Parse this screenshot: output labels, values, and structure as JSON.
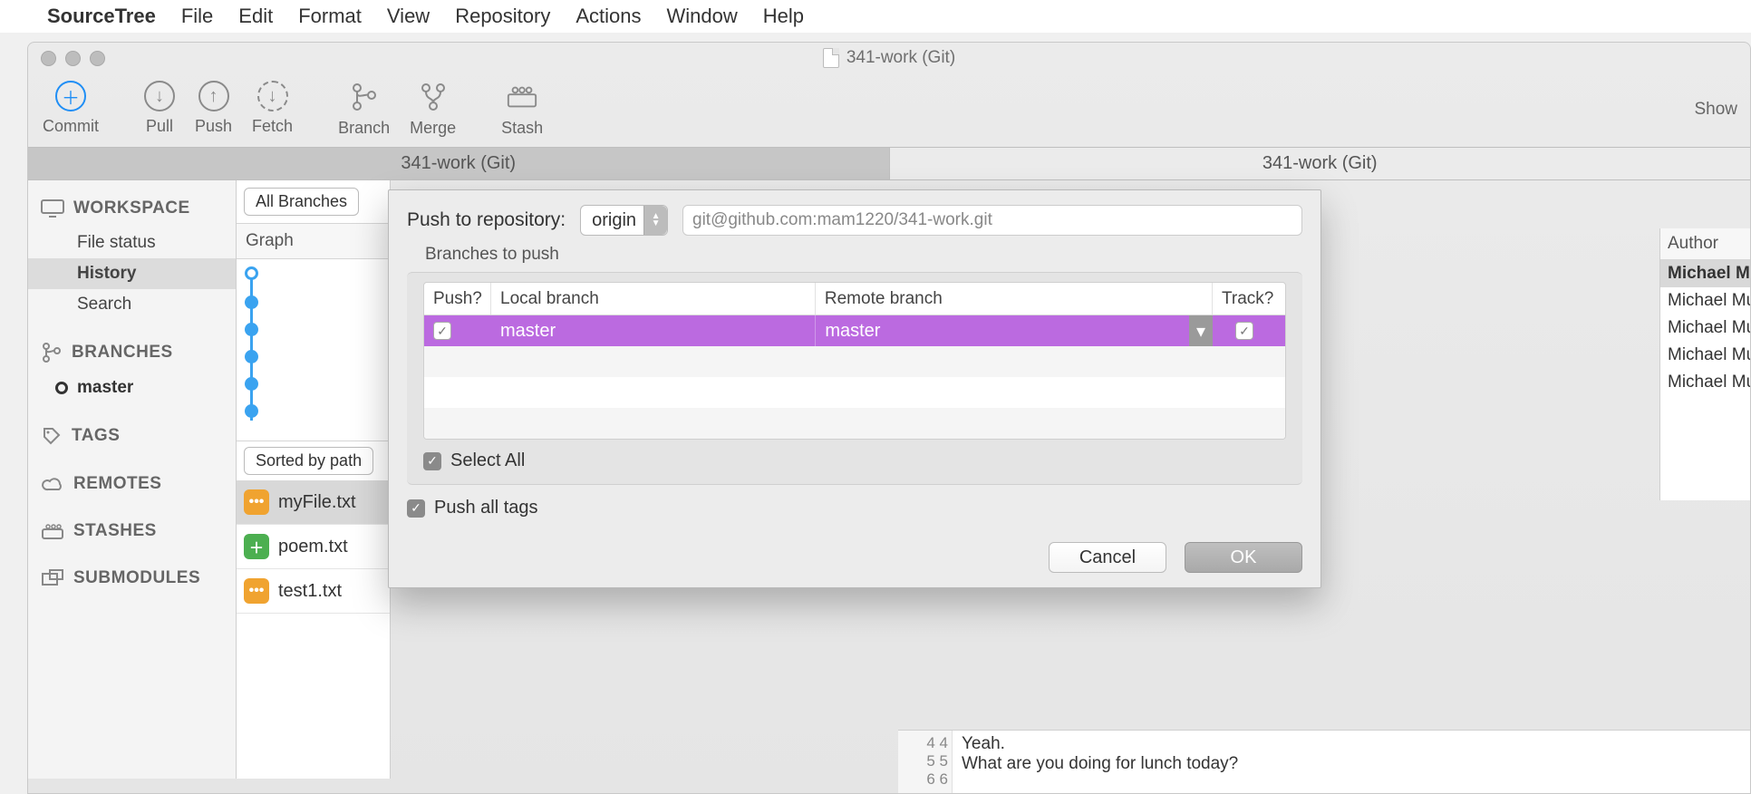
{
  "menubar": {
    "app": "SourceTree",
    "items": [
      "File",
      "Edit",
      "Format",
      "View",
      "Repository",
      "Actions",
      "Window",
      "Help"
    ]
  },
  "window_title": "341-work (Git)",
  "toolbar": {
    "commit": "Commit",
    "pull": "Pull",
    "push": "Push",
    "fetch": "Fetch",
    "branch": "Branch",
    "merge": "Merge",
    "stash": "Stash",
    "show": "Show"
  },
  "tabs": {
    "left": "341-work (Git)",
    "right": "341-work (Git)"
  },
  "sidebar": {
    "workspace": "WORKSPACE",
    "ws_items": [
      "File status",
      "History",
      "Search"
    ],
    "branches": "BRANCHES",
    "branch": "master",
    "tags": "TAGS",
    "remotes": "REMOTES",
    "stashes": "STASHES",
    "submodules": "SUBMODULES"
  },
  "mid": {
    "all_branches": "All Branches",
    "graph": "Graph",
    "sorted": "Sorted by path",
    "files": [
      {
        "name": "myFile.txt",
        "type": "mod"
      },
      {
        "name": "poem.txt",
        "type": "add"
      },
      {
        "name": "test1.txt",
        "type": "mod"
      }
    ]
  },
  "right": {
    "author_hdr": "Author",
    "rows": [
      "Michael Mu",
      "Michael Mu",
      "Michael Mu",
      "Michael Mu",
      "Michael Mu"
    ]
  },
  "diff": {
    "g1": "4  4",
    "g2": "5  5",
    "g3": "6  6",
    "l1": "Yeah.",
    "l2": "",
    "l3": "What are you doing for lunch today?"
  },
  "modal": {
    "push_label": "Push to repository:",
    "remote": "origin",
    "url": "git@github.com:mam1220/341-work.git",
    "branches_to_push": "Branches to push",
    "th_push": "Push?",
    "th_local": "Local branch",
    "th_remote": "Remote branch",
    "th_track": "Track?",
    "row_local": "master",
    "row_remote": "master",
    "select_all": "Select All",
    "push_tags": "Push all tags",
    "cancel": "Cancel",
    "ok": "OK"
  }
}
